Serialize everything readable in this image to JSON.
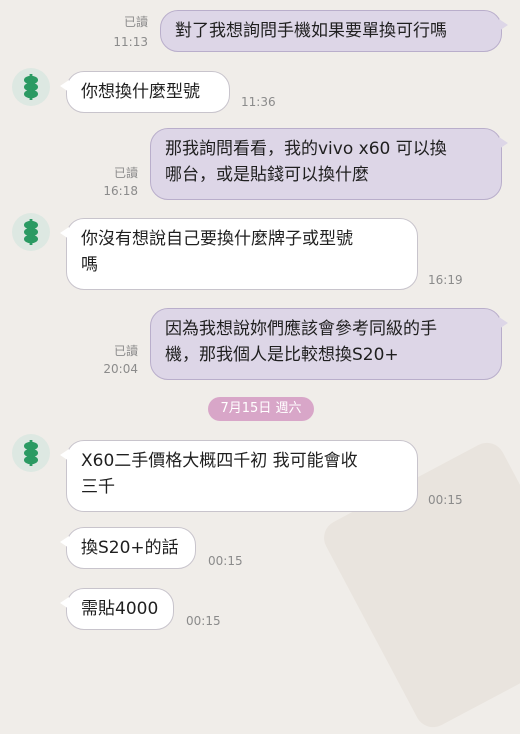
{
  "messages": {
    "m1": {
      "text": "對了我想詢問手機如果要單換可行嗎",
      "read": "已讀",
      "time": "11:13"
    },
    "m2": {
      "text": "你想換什麼型號",
      "time": "11:36"
    },
    "m3": {
      "text": "那我詢問看看，我的vivo x60 可以換\n哪台，或是貼錢可以換什麼",
      "read": "已讀",
      "time": "16:18"
    },
    "m4": {
      "text": "你沒有想說自己要換什麼牌子或型號\n嗎",
      "time": "16:19"
    },
    "m5": {
      "text": "因為我想說妳們應該會參考同級的手\n機，那我個人是比較想換S20+",
      "read": "已讀",
      "time": "20:04"
    },
    "date_badge": "7月15日 週六",
    "m6": {
      "text": "X60二手價格大概四千初 我可能會收\n三千",
      "time": "00:15"
    },
    "m7": {
      "text": "換S20+的話",
      "time": "00:15"
    },
    "m8": {
      "text": "需貼4000",
      "time": "00:15"
    }
  },
  "colors": {
    "background": "#f0ede9",
    "outgoing_bubble": "#ddd6e7",
    "incoming_bubble": "#ffffff",
    "date_badge": "#d8a6c8",
    "avatar_icon": "#2b9a63"
  },
  "icons": {
    "avatar": "green-stacked-avatar-icon"
  }
}
